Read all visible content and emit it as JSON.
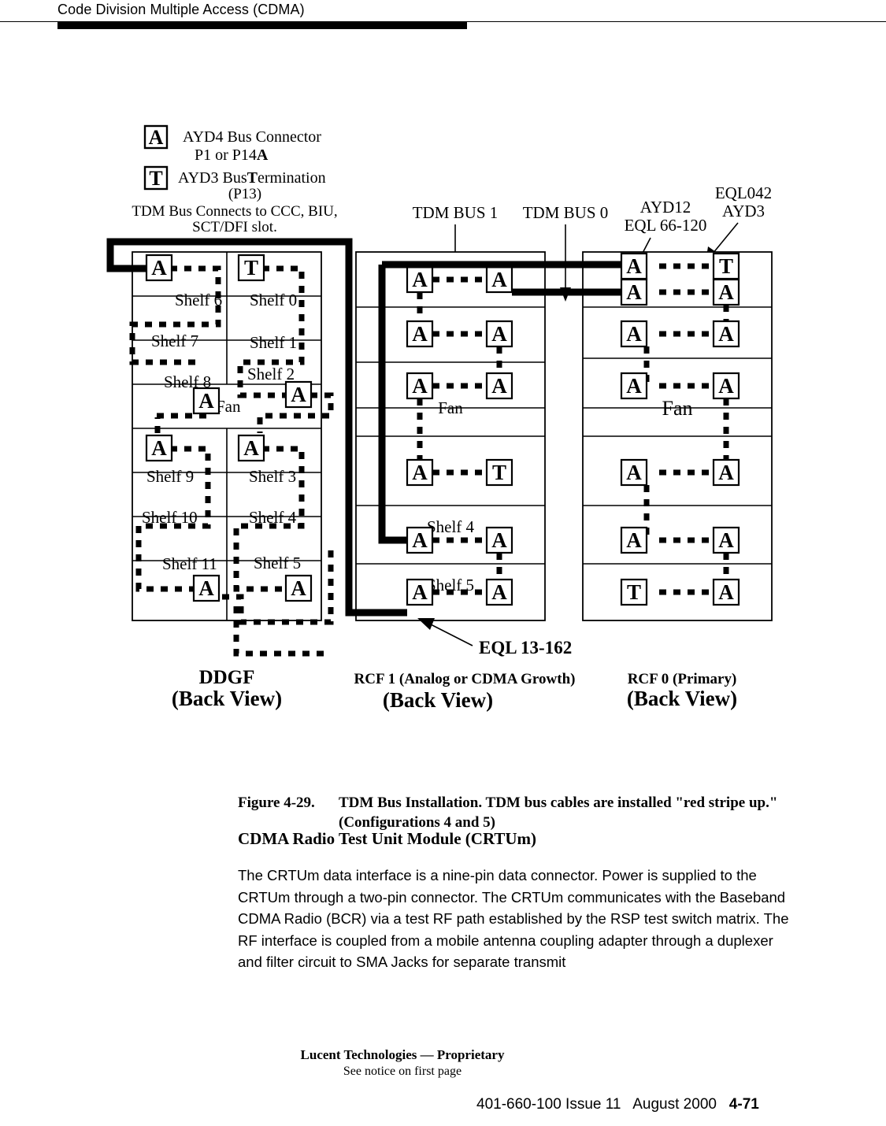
{
  "header": {
    "running_title": "Code Division Multiple Access (CDMA)"
  },
  "figure": {
    "legend": {
      "connector_key": "A",
      "connector_line1": "AYD4 Bus Connector",
      "connector_line2a": "P1 or P14",
      "connector_line2b": "A",
      "termination_key": "T",
      "termination_line1a": "AYD3 Bus",
      "termination_line1b": "T",
      "termination_line1c": "ermination",
      "termination_line2": "(P13)",
      "note_line1": "TDM Bus Connects to CCC, BIU,",
      "note_line2": "SCT/DFI slot."
    },
    "callouts": {
      "tdm_bus_1": "TDM BUS 1",
      "tdm_bus_0": "TDM BUS 0",
      "ayd12": "AYD12",
      "eql_66_120": "EQL 66-120",
      "eql042": "EQL042",
      "ayd3": "AYD3",
      "eql_13_162": "EQL 13-162"
    },
    "racks": [
      {
        "id": "ddgf",
        "name_line1": "DDGF",
        "name_line2": "(Back View)",
        "columns": 2,
        "left_column_shelves": [
          "Shelf 6",
          "Shelf 7",
          "Shelf 8",
          "Shelf 9",
          "Shelf 10",
          "Shelf 11"
        ],
        "right_column_shelves": [
          "Shelf 0",
          "Shelf 1",
          "Shelf 2",
          "Shelf 3",
          "Shelf 4",
          "Shelf 5"
        ],
        "fan_label": "Fan",
        "connectors": [
          {
            "row": "shelf6",
            "col": "left",
            "type": "A"
          },
          {
            "row": "shelf0",
            "col": "right",
            "type": "T"
          },
          {
            "row": "shelf8",
            "col": "left",
            "type": "A"
          },
          {
            "row": "shelf2",
            "col": "right",
            "type": "A"
          },
          {
            "row": "shelf9",
            "col": "left",
            "type": "A"
          },
          {
            "row": "shelf3",
            "col": "right",
            "type": "A"
          },
          {
            "row": "shelf11",
            "col": "left",
            "type": "A"
          },
          {
            "row": "shelf5",
            "col": "right",
            "type": "A"
          }
        ]
      },
      {
        "id": "rcf1",
        "name_line1": "RCF 1 (Analog or CDMA Growth)",
        "name_line2": "(Back View)",
        "columns": 1,
        "shelf_labels": [
          "",
          "",
          "",
          "",
          "Shelf 4",
          "Shelf 5"
        ],
        "fan_label": "Fan",
        "rows": [
          {
            "left": "A",
            "right": "A"
          },
          {
            "left": "A",
            "right": "A"
          },
          {
            "left": "A",
            "right": "A"
          },
          {
            "left": "A",
            "right": "T"
          },
          {
            "left": "A",
            "right": "A"
          },
          {
            "left": "A",
            "right": "A"
          }
        ]
      },
      {
        "id": "rcf0",
        "name_line1": "RCF 0 (Primary)",
        "name_line2": "(Back View)",
        "columns": 1,
        "fan_label": "Fan",
        "rows": [
          {
            "left": "A",
            "right": "T"
          },
          {
            "left": "A",
            "right": "A"
          },
          {
            "left": "A",
            "right": "A"
          },
          {
            "left": "A",
            "right": "A"
          },
          {
            "left": "A",
            "right": "A"
          },
          {
            "left": "A",
            "right": "A"
          },
          {
            "left": "T",
            "right": "A"
          }
        ]
      }
    ]
  },
  "caption": {
    "number": "Figure 4-29.",
    "text": "TDM Bus Installation. TDM bus cables are installed \"red stripe up.\" (Configurations 4 and 5)"
  },
  "section_heading": "CDMA Radio Test Unit Module (CRTUm)",
  "body_paragraph": "The CRTUm data interface is a nine-pin data connector. Power is supplied to the CRTUm through a two-pin connector. The CRTUm communicates with the Baseband CDMA Radio (BCR) via a test RF path established by the RSP test switch matrix. The RF interface is coupled from a mobile antenna coupling adapter through a duplexer and filter circuit to SMA Jacks for separate transmit",
  "footer": {
    "proprietary": "Lucent Technologies — Proprietary",
    "notice": "See notice on first page",
    "doc_number": "401-660-100 Issue 11",
    "date": "August 2000",
    "page": "4-71"
  }
}
